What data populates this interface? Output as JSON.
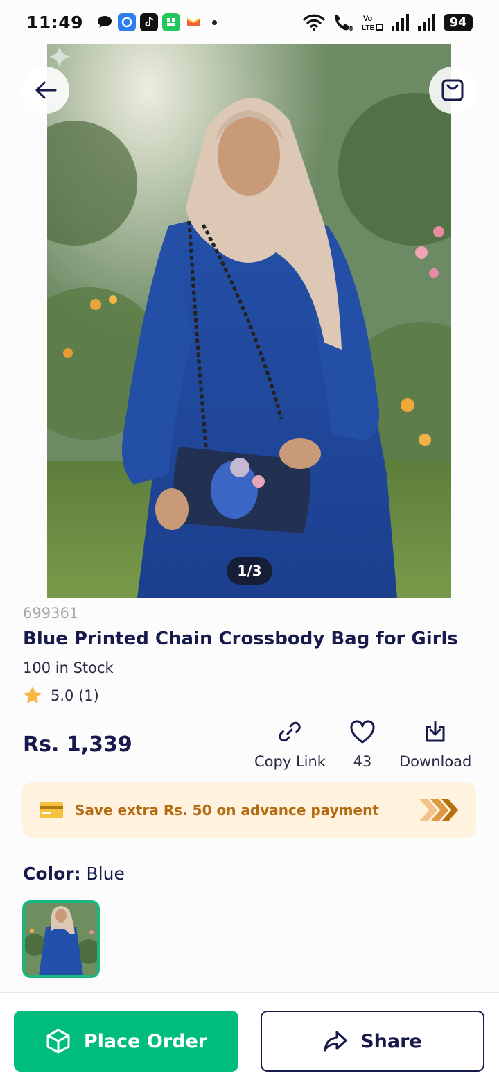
{
  "status_bar": {
    "time": "11:49",
    "battery": "94",
    "notification_icons": [
      "chat-bubble-icon",
      "app-blue-icon",
      "tiktok-icon",
      "app-green-icon",
      "app-orange-icon"
    ],
    "right_icons": [
      "wifi-icon",
      "wifi-call-icon",
      "volte-icon",
      "signal-icon",
      "signal-icon"
    ]
  },
  "hero": {
    "counter": "1/3"
  },
  "product": {
    "sku": "699361",
    "title": "Blue Printed Chain Crossbody Bag for Girls",
    "stock": "100 in Stock",
    "rating": "5.0 (1)",
    "price": "Rs. 1,339"
  },
  "actions": {
    "copy_link": "Copy Link",
    "likes": "43",
    "download": "Download"
  },
  "promo": {
    "text": "Save extra Rs. 50 on advance payment"
  },
  "color": {
    "label": "Color:",
    "value": "Blue"
  },
  "bottom": {
    "place_order": "Place Order",
    "share": "Share"
  },
  "colors": {
    "accent_green": "#00bd7e",
    "navy": "#171a4a",
    "promo_bg": "#fff3df",
    "promo_text": "#b36a10",
    "star": "#f5b942"
  }
}
